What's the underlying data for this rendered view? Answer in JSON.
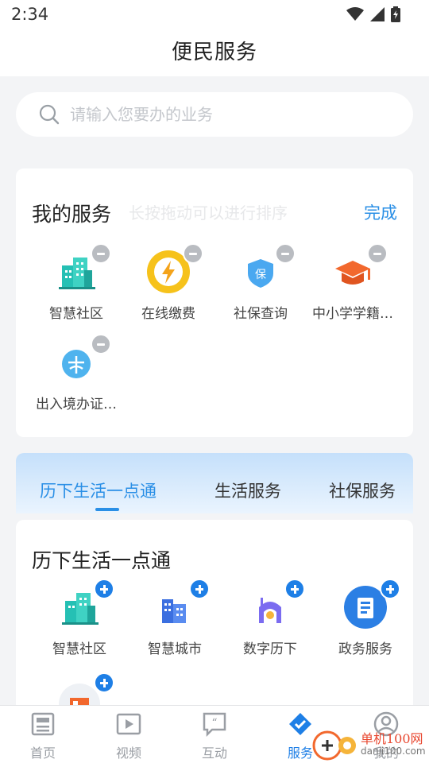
{
  "status_bar": {
    "time": "2:34"
  },
  "header": {
    "title": "便民服务"
  },
  "search": {
    "placeholder": "请输入您要办的业务"
  },
  "my_services": {
    "heading": "我的服务",
    "hint": "长按拖动可以进行排序",
    "done_label": "完成",
    "items": [
      {
        "label": "智慧社区",
        "icon": "community-icon"
      },
      {
        "label": "在线缴费",
        "icon": "payment-icon"
      },
      {
        "label": "社保查询",
        "icon": "social-security-icon"
      },
      {
        "label": "中小学学籍…",
        "icon": "school-record-icon"
      },
      {
        "label": "出入境办证…",
        "icon": "immigration-icon"
      }
    ]
  },
  "category_tabs": [
    {
      "label": "历下生活一点通",
      "active": true
    },
    {
      "label": "生活服务",
      "active": false
    },
    {
      "label": "社保服务",
      "active": false
    }
  ],
  "section": {
    "heading": "历下生活一点通",
    "items": [
      {
        "label": "智慧社区",
        "icon": "community-icon"
      },
      {
        "label": "智慧城市",
        "icon": "smart-city-icon"
      },
      {
        "label": "数字历下",
        "icon": "digital-lixia-icon"
      },
      {
        "label": "政务服务",
        "icon": "government-service-icon"
      }
    ]
  },
  "bottom_nav": [
    {
      "label": "首页",
      "icon": "home-icon",
      "active": false
    },
    {
      "label": "视频",
      "icon": "video-icon",
      "active": false
    },
    {
      "label": "互动",
      "icon": "interaction-icon",
      "active": false
    },
    {
      "label": "服务",
      "icon": "service-icon",
      "active": true
    },
    {
      "label": "我的",
      "icon": "profile-icon",
      "active": false
    }
  ],
  "watermark": {
    "text": "单机100网",
    "url": "danji100.com"
  },
  "colors": {
    "accent": "#2a8fe6",
    "teal": "#25c0b4",
    "orange": "#f2682d",
    "badge_grey": "#b9bcc1"
  }
}
